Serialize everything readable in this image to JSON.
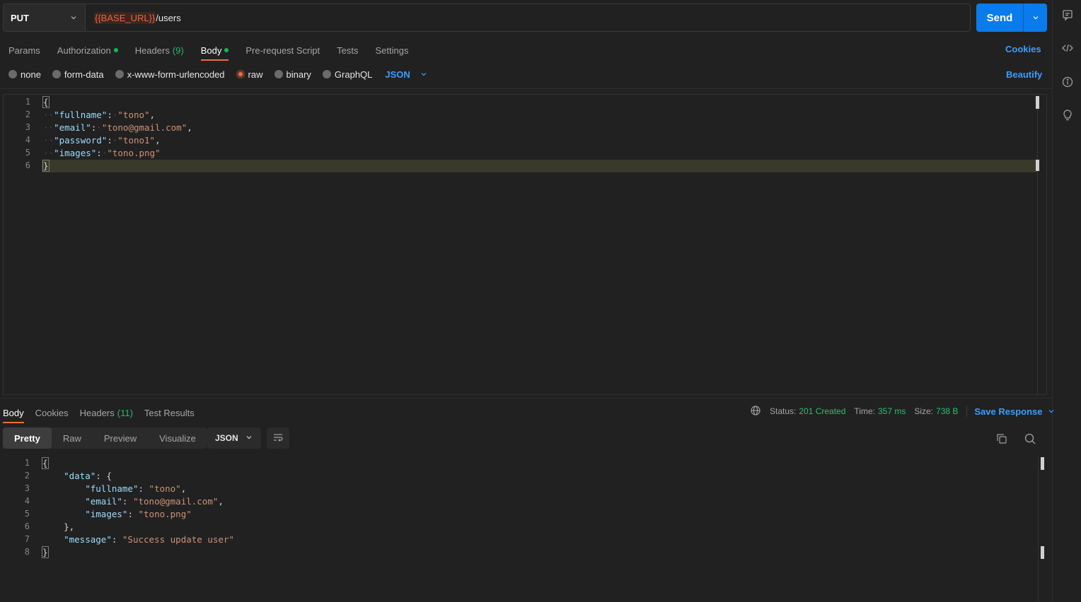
{
  "request": {
    "method": "PUT",
    "url_variable": "{{BASE_URL}}",
    "url_path": "/users",
    "send_label": "Send"
  },
  "request_tabs": [
    {
      "label": "Params"
    },
    {
      "label": "Authorization"
    },
    {
      "label": "Headers",
      "count": "(9)"
    },
    {
      "label": "Body"
    },
    {
      "label": "Pre-request Script"
    },
    {
      "label": "Tests"
    },
    {
      "label": "Settings"
    }
  ],
  "cookies_label": "Cookies",
  "body_types": [
    "none",
    "form-data",
    "x-www-form-urlencoded",
    "raw",
    "binary",
    "GraphQL"
  ],
  "body_language": "JSON",
  "beautify_label": "Beautify",
  "request_body": {
    "line_numbers": [
      "1",
      "2",
      "3",
      "4",
      "5",
      "6"
    ],
    "open_brace": "{",
    "close_brace": "}",
    "fields": [
      {
        "key": "\"fullname\"",
        "value": "\"tono\"",
        "trail": ","
      },
      {
        "key": "\"email\"",
        "value": "\"tono@gmail.com\"",
        "trail": ","
      },
      {
        "key": "\"password\"",
        "value": "\"tono1\"",
        "trail": ","
      },
      {
        "key": "\"images\"",
        "value": "\"tono.png\"",
        "trail": ""
      }
    ]
  },
  "response_tabs": [
    {
      "label": "Body"
    },
    {
      "label": "Cookies"
    },
    {
      "label": "Headers",
      "count": "(11)"
    },
    {
      "label": "Test Results"
    }
  ],
  "response_status": {
    "status_label": "Status:",
    "status_value": "201 Created",
    "time_label": "Time:",
    "time_value": "357 ms",
    "size_label": "Size:",
    "size_value": "738 B",
    "save_label": "Save Response"
  },
  "view_modes": [
    "Pretty",
    "Raw",
    "Preview",
    "Visualize"
  ],
  "response_format": "JSON",
  "response_body": {
    "line_numbers": [
      "1",
      "2",
      "3",
      "4",
      "5",
      "6",
      "7",
      "8"
    ],
    "open_brace": "{",
    "data_key": "\"data\"",
    "data_open": ": {",
    "fields": [
      {
        "key": "\"fullname\"",
        "value": "\"tono\"",
        "trail": ","
      },
      {
        "key": "\"email\"",
        "value": "\"tono@gmail.com\"",
        "trail": ","
      },
      {
        "key": "\"images\"",
        "value": "\"tono.png\"",
        "trail": ""
      }
    ],
    "data_close": "},",
    "message_key": "\"message\"",
    "message_value": "\"Success update user\"",
    "close_brace": "}"
  },
  "colors": {
    "accent_blue": "#097bed",
    "link_blue": "#3b9eff",
    "tab_underline": "#f26b3a",
    "status_green": "#2fbf71",
    "variable_red": "#f5623a"
  },
  "icons": [
    "chevron-down-icon",
    "comment-icon",
    "code-icon",
    "info-icon",
    "lightbulb-icon",
    "globe-icon",
    "wrap-lines-icon",
    "copy-icon",
    "search-icon"
  ]
}
